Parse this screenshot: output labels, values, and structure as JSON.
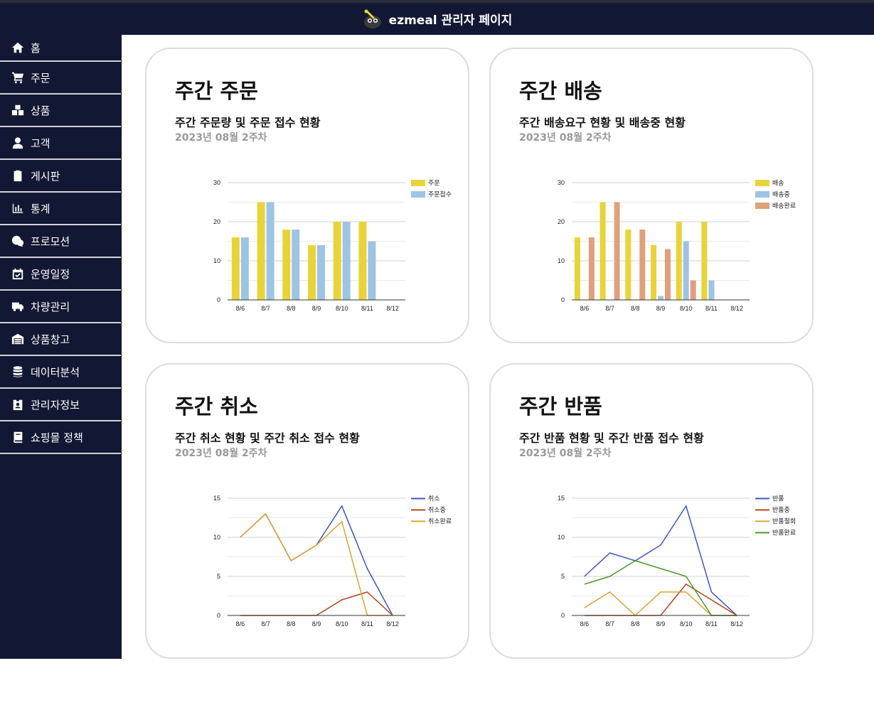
{
  "header": {
    "title": "ezmeal 관리자 페이지",
    "logo_icon": "chef-mascot-icon"
  },
  "sidebar": {
    "items": [
      {
        "label": "홈",
        "icon": "home-icon"
      },
      {
        "label": "주문",
        "icon": "cart-icon"
      },
      {
        "label": "상품",
        "icon": "boxes-icon"
      },
      {
        "label": "고객",
        "icon": "user-icon"
      },
      {
        "label": "게시판",
        "icon": "clipboard-icon"
      },
      {
        "label": "통계",
        "icon": "bar-chart-icon"
      },
      {
        "label": "프로모션",
        "icon": "promotion-icon"
      },
      {
        "label": "운영일정",
        "icon": "calendar-check-icon"
      },
      {
        "label": "차량관리",
        "icon": "truck-icon"
      },
      {
        "label": "상품창고",
        "icon": "warehouse-icon"
      },
      {
        "label": "데이터분석",
        "icon": "database-icon"
      },
      {
        "label": "관리자정보",
        "icon": "id-badge-icon"
      },
      {
        "label": "쇼핑몰 정책",
        "icon": "book-icon"
      }
    ]
  },
  "cards": [
    {
      "title": "주간 주문",
      "subtitle": "주간 주문량 및 주문 접수 현황",
      "date": "2023년 08월 2주차"
    },
    {
      "title": "주간 배송",
      "subtitle": "주간 배송요구 현황 및 배송중 현황",
      "date": "2023년 08월 2주차"
    },
    {
      "title": "주간 취소",
      "subtitle": "주간 취소 현황 및 주간 취소 접수 현황",
      "date": "2023년 08월 2주차"
    },
    {
      "title": "주간 반품",
      "subtitle": "주간 반품 현황 및 주간 반품 접수 현황",
      "date": "2023년 08월 2주차"
    }
  ],
  "chart_data": [
    {
      "type": "bar",
      "categories": [
        "8/6",
        "8/7",
        "8/8",
        "8/9",
        "8/10",
        "8/11",
        "8/12"
      ],
      "ylim": [
        0,
        30
      ],
      "yticks": [
        0,
        10,
        20,
        30
      ],
      "legend": "right",
      "series": [
        {
          "name": "주문",
          "color": "#e8d43a",
          "values": [
            16,
            25,
            18,
            14,
            20,
            20,
            0
          ]
        },
        {
          "name": "주문접수",
          "color": "#9dc4e4",
          "values": [
            16,
            25,
            18,
            14,
            20,
            15,
            0
          ]
        }
      ]
    },
    {
      "type": "bar",
      "categories": [
        "8/6",
        "8/7",
        "8/8",
        "8/9",
        "8/10",
        "8/11",
        "8/12"
      ],
      "ylim": [
        0,
        30
      ],
      "yticks": [
        0,
        10,
        20,
        30
      ],
      "legend": "right",
      "series": [
        {
          "name": "배송",
          "color": "#e8d43a",
          "values": [
            16,
            25,
            18,
            14,
            20,
            20,
            0
          ]
        },
        {
          "name": "배송중",
          "color": "#9dc4e4",
          "values": [
            0,
            0,
            0,
            1,
            15,
            5,
            0
          ]
        },
        {
          "name": "배송완료",
          "color": "#e0a07c",
          "values": [
            16,
            25,
            18,
            13,
            5,
            0,
            0
          ]
        }
      ]
    },
    {
      "type": "line",
      "categories": [
        "8/6",
        "8/7",
        "8/8",
        "8/9",
        "8/10",
        "8/11",
        "8/12"
      ],
      "ylim": [
        0,
        15
      ],
      "yticks": [
        0,
        5,
        10,
        15
      ],
      "legend": "right",
      "series": [
        {
          "name": "취소",
          "color": "#3d55c0",
          "values": [
            10,
            13,
            7,
            9,
            14,
            6,
            0
          ]
        },
        {
          "name": "취소중",
          "color": "#b5441a",
          "values": [
            0,
            0,
            0,
            0,
            2,
            3,
            0
          ]
        },
        {
          "name": "취소완료",
          "color": "#e0a030",
          "values": [
            10,
            13,
            7,
            9,
            12,
            0,
            0
          ]
        }
      ]
    },
    {
      "type": "line",
      "categories": [
        "8/6",
        "8/7",
        "8/8",
        "8/9",
        "8/10",
        "8/11",
        "8/12"
      ],
      "ylim": [
        0,
        15
      ],
      "yticks": [
        0,
        5,
        10,
        15
      ],
      "legend": "right",
      "series": [
        {
          "name": "반품",
          "color": "#3d55c0",
          "values": [
            5,
            8,
            7,
            9,
            14,
            3,
            0
          ]
        },
        {
          "name": "반품중",
          "color": "#b5441a",
          "values": [
            0,
            0,
            0,
            0,
            4,
            2,
            0
          ]
        },
        {
          "name": "반품철회",
          "color": "#e0a030",
          "values": [
            1,
            3,
            0,
            3,
            3,
            0,
            0
          ]
        },
        {
          "name": "반품완료",
          "color": "#4a9a2a",
          "values": [
            4,
            5,
            7,
            6,
            5,
            0,
            0
          ]
        }
      ]
    }
  ]
}
